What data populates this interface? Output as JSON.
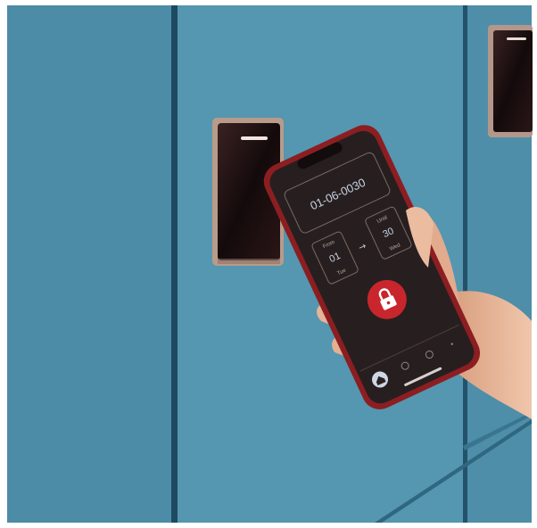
{
  "scene": {
    "description_colors": {
      "wall": "#4f8ea8",
      "wall_dark": "#3c7791",
      "seam": "#1f4f66",
      "reader_frame": "#b69a8a",
      "reader_glass": "#1a0f10",
      "phone_body": "#8a1f24",
      "phone_screen": "#2a2222",
      "accent_red": "#c8262c",
      "skin": "#e9b89a"
    }
  },
  "phone_app": {
    "locker_code": "01-06-0030",
    "from_label": "From",
    "from_day": "01",
    "from_weekday": "Tue",
    "arrow": "→",
    "until_label": "Until",
    "until_day": "30",
    "until_weekday": "Wed",
    "lock_icon": "lock-icon",
    "nav_icons": [
      "home-icon",
      "history-icon",
      "settings-icon",
      "more-icon"
    ]
  }
}
